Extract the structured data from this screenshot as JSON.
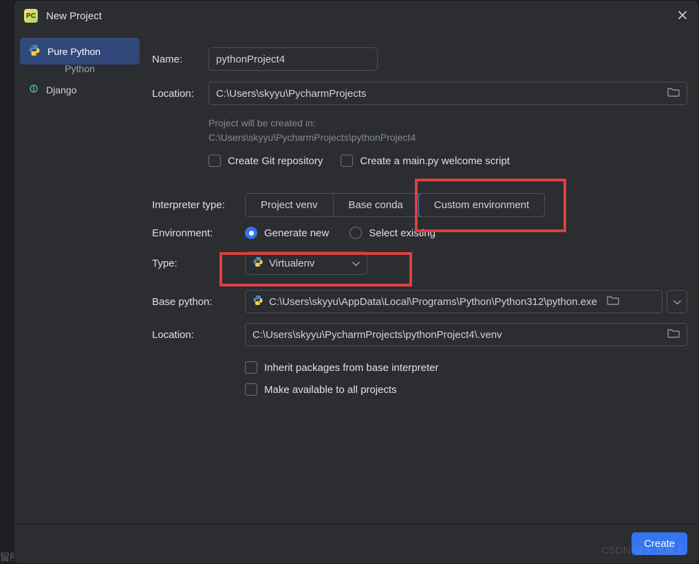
{
  "window": {
    "title": "New Project"
  },
  "sidebar": {
    "items": [
      {
        "label": "Pure Python",
        "selected": true,
        "icon": "python-icon"
      },
      {
        "label": "Django",
        "selected": false,
        "icon": "django-icon"
      }
    ],
    "subtitle": "Python"
  },
  "form": {
    "name_label": "Name:",
    "name_value": "pythonProject4",
    "location_label": "Location:",
    "location_value": "C:\\Users\\skyyu\\PycharmProjects",
    "hint_line1": "Project will be created in:",
    "hint_line2": "C:\\Users\\skyyu\\PycharmProjects\\pythonProject4",
    "git_checkbox": "Create Git repository",
    "mainpy_checkbox": "Create a main.py welcome script",
    "interpreter_label": "Interpreter type:",
    "interpreter_options": [
      "Project venv",
      "Base conda",
      "Custom environment"
    ],
    "interpreter_selected": "Custom environment",
    "env_label": "Environment:",
    "env_generate": "Generate new",
    "env_select": "Select existing",
    "type_label": "Type:",
    "type_value": "Virtualenv",
    "base_python_label": "Base python:",
    "base_python_value": "C:\\Users\\skyyu\\AppData\\Local\\Programs\\Python\\Python312\\python.exe",
    "venv_location_label": "Location:",
    "venv_location_value": "C:\\Users\\skyyu\\PycharmProjects\\pythonProject4\\.venv",
    "inherit_checkbox": "Inherit packages from base interpreter",
    "available_checkbox": "Make available to all projects"
  },
  "footer": {
    "create_button": "Create"
  },
  "watermark": "CSDN @天龙真人",
  "chinese_fragment": "留所有权利。"
}
